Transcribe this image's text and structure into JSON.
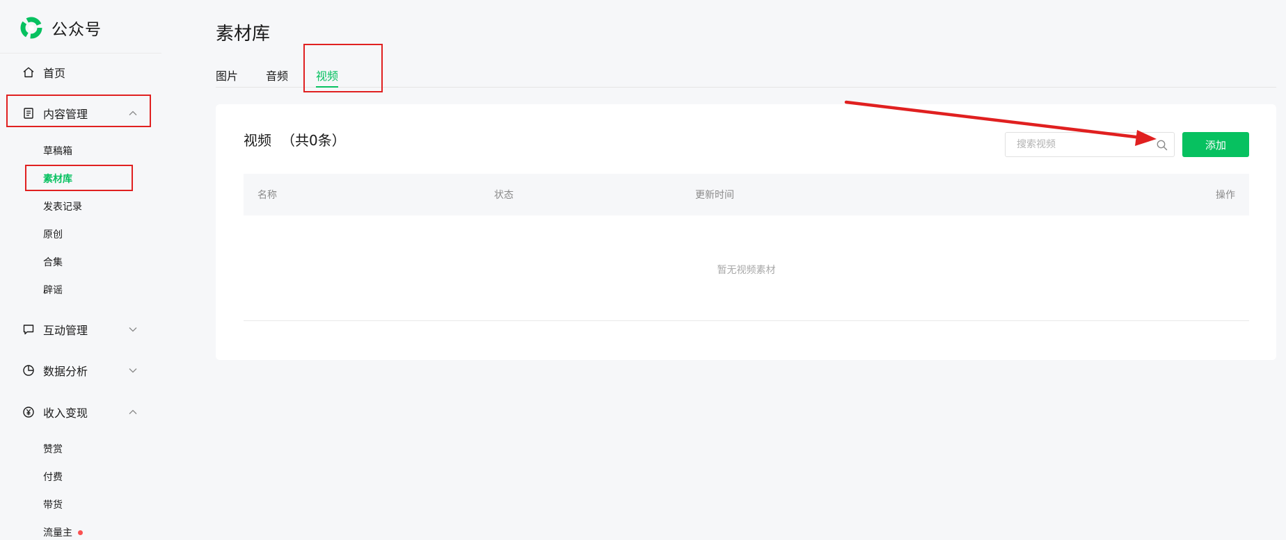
{
  "app": {
    "name": "公众号",
    "brand_color": "#07c160"
  },
  "sidebar": {
    "home": {
      "label": "首页",
      "icon": "home-icon"
    },
    "content": {
      "label": "内容管理",
      "icon": "document-icon",
      "expanded": true,
      "items": [
        {
          "label": "草稿箱"
        },
        {
          "label": "素材库",
          "active": true
        },
        {
          "label": "发表记录"
        },
        {
          "label": "原创"
        },
        {
          "label": "合集"
        },
        {
          "label": "辟谣"
        }
      ]
    },
    "interaction": {
      "label": "互动管理",
      "icon": "comment-icon",
      "expanded": false
    },
    "analytics": {
      "label": "数据分析",
      "icon": "pie-chart-icon",
      "expanded": false
    },
    "monetization": {
      "label": "收入变现",
      "icon": "yuan-icon",
      "expanded": true,
      "items": [
        {
          "label": "赞赏"
        },
        {
          "label": "付费"
        },
        {
          "label": "带货"
        },
        {
          "label": "流量主",
          "badge": "red-dot"
        }
      ]
    }
  },
  "main": {
    "title": "素材库",
    "tabs": [
      {
        "label": "图片"
      },
      {
        "label": "音频"
      },
      {
        "label": "视频",
        "active": true
      }
    ],
    "section": {
      "title": "视频",
      "count": "（共0条）"
    },
    "search": {
      "placeholder": "搜索视频",
      "value": ""
    },
    "add_label": "添加",
    "table": {
      "columns": [
        "名称",
        "状态",
        "更新时间",
        "操作"
      ],
      "rows": [],
      "empty_text": "暂无视频素材"
    }
  },
  "annotations": {
    "highlight_color": "#e02020",
    "arrow_target": "search-icon"
  }
}
